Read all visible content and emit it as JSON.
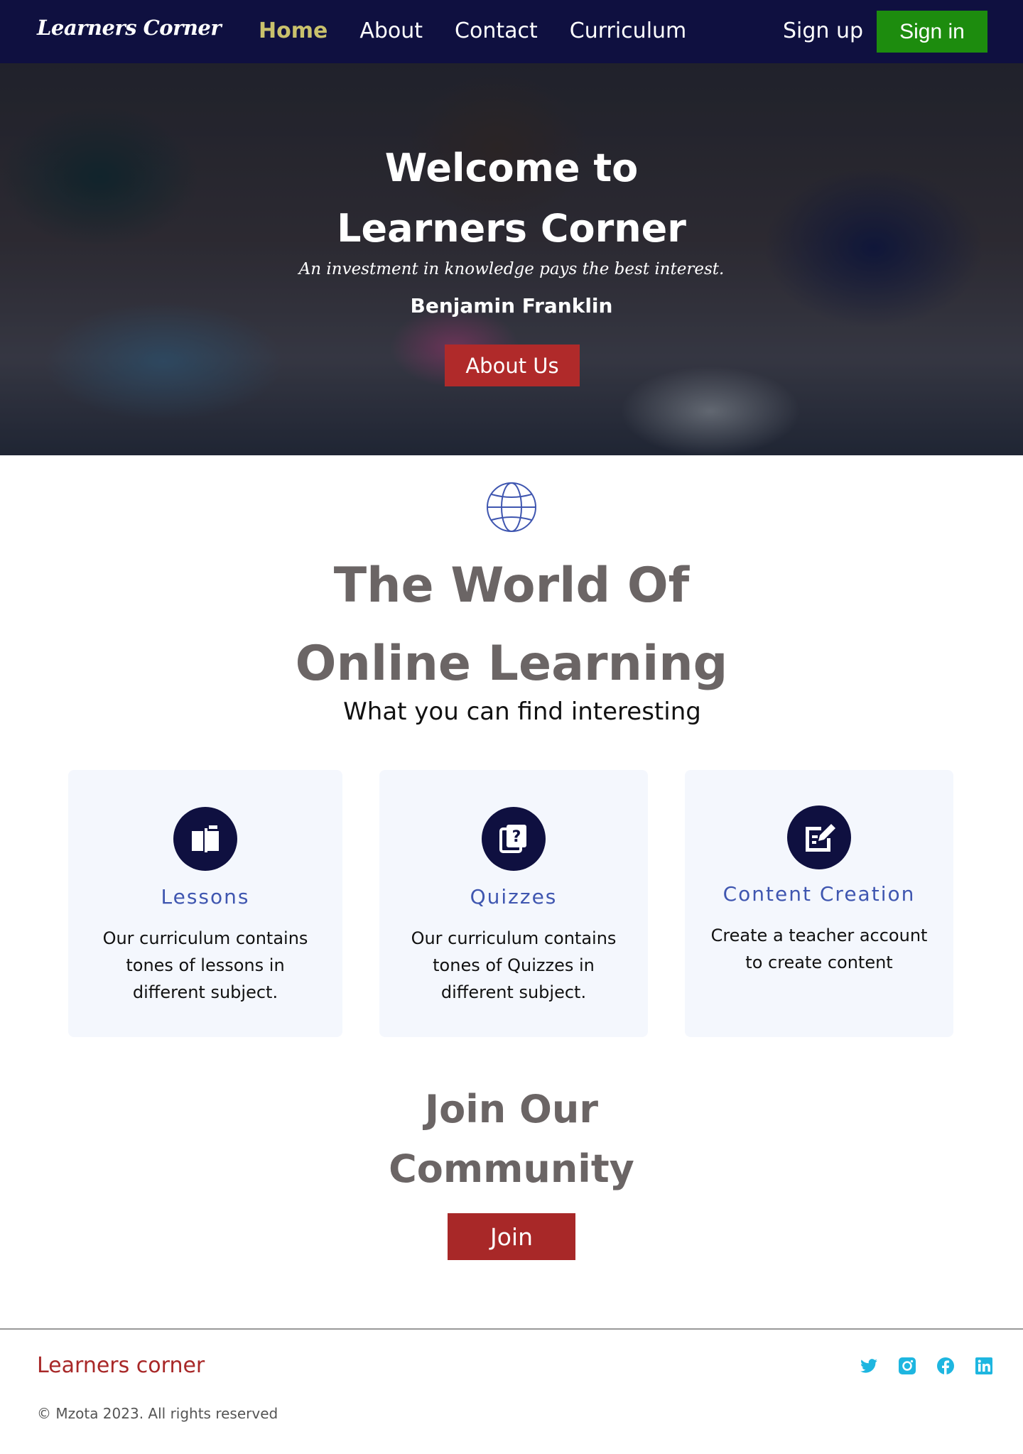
{
  "nav": {
    "brand": "Learners Corner",
    "links": [
      "Home",
      "About",
      "Contact",
      "Curriculum"
    ],
    "active": "Home",
    "signup": "Sign up",
    "signin": "Sign in"
  },
  "hero": {
    "title_line1": "Welcome to",
    "title_line2": "Learners Corner",
    "quote": "An investment in knowledge pays the best interest.",
    "author": "Benjamin Franklin",
    "button": "About Us"
  },
  "world": {
    "icon": "globe-icon",
    "title_line1": "The World Of",
    "title_line2": "Online Learning",
    "subtitle": "What you can find interesting"
  },
  "cards": [
    {
      "icon": "book-icon",
      "title": "Lessons",
      "desc": "Our curriculum contains tones of  lessons in different subject."
    },
    {
      "icon": "quiz-icon",
      "title": "Quizzes",
      "desc": "Our curriculum contains tones of  Quizzes in different subject."
    },
    {
      "icon": "edit-icon",
      "title": "Content Creation",
      "desc": "Create a teacher account to create content"
    }
  ],
  "join": {
    "title_line1": "Join Our",
    "title_line2": "Community",
    "button": "Join"
  },
  "footer": {
    "brand": "Learners corner",
    "copyright": "© Mzota 2023.  All rights reserved",
    "socials": [
      "twitter-icon",
      "instagram-icon",
      "facebook-icon",
      "linkedin-icon"
    ],
    "social_color": "#1eb6e0"
  },
  "colors": {
    "nav_bg": "#0f1040",
    "accent_green": "#1d8c0e",
    "accent_red": "#b02a2a",
    "active_link": "#c9c16c",
    "heading_gray": "#6b6565",
    "card_title_blue": "#3f56b0"
  }
}
